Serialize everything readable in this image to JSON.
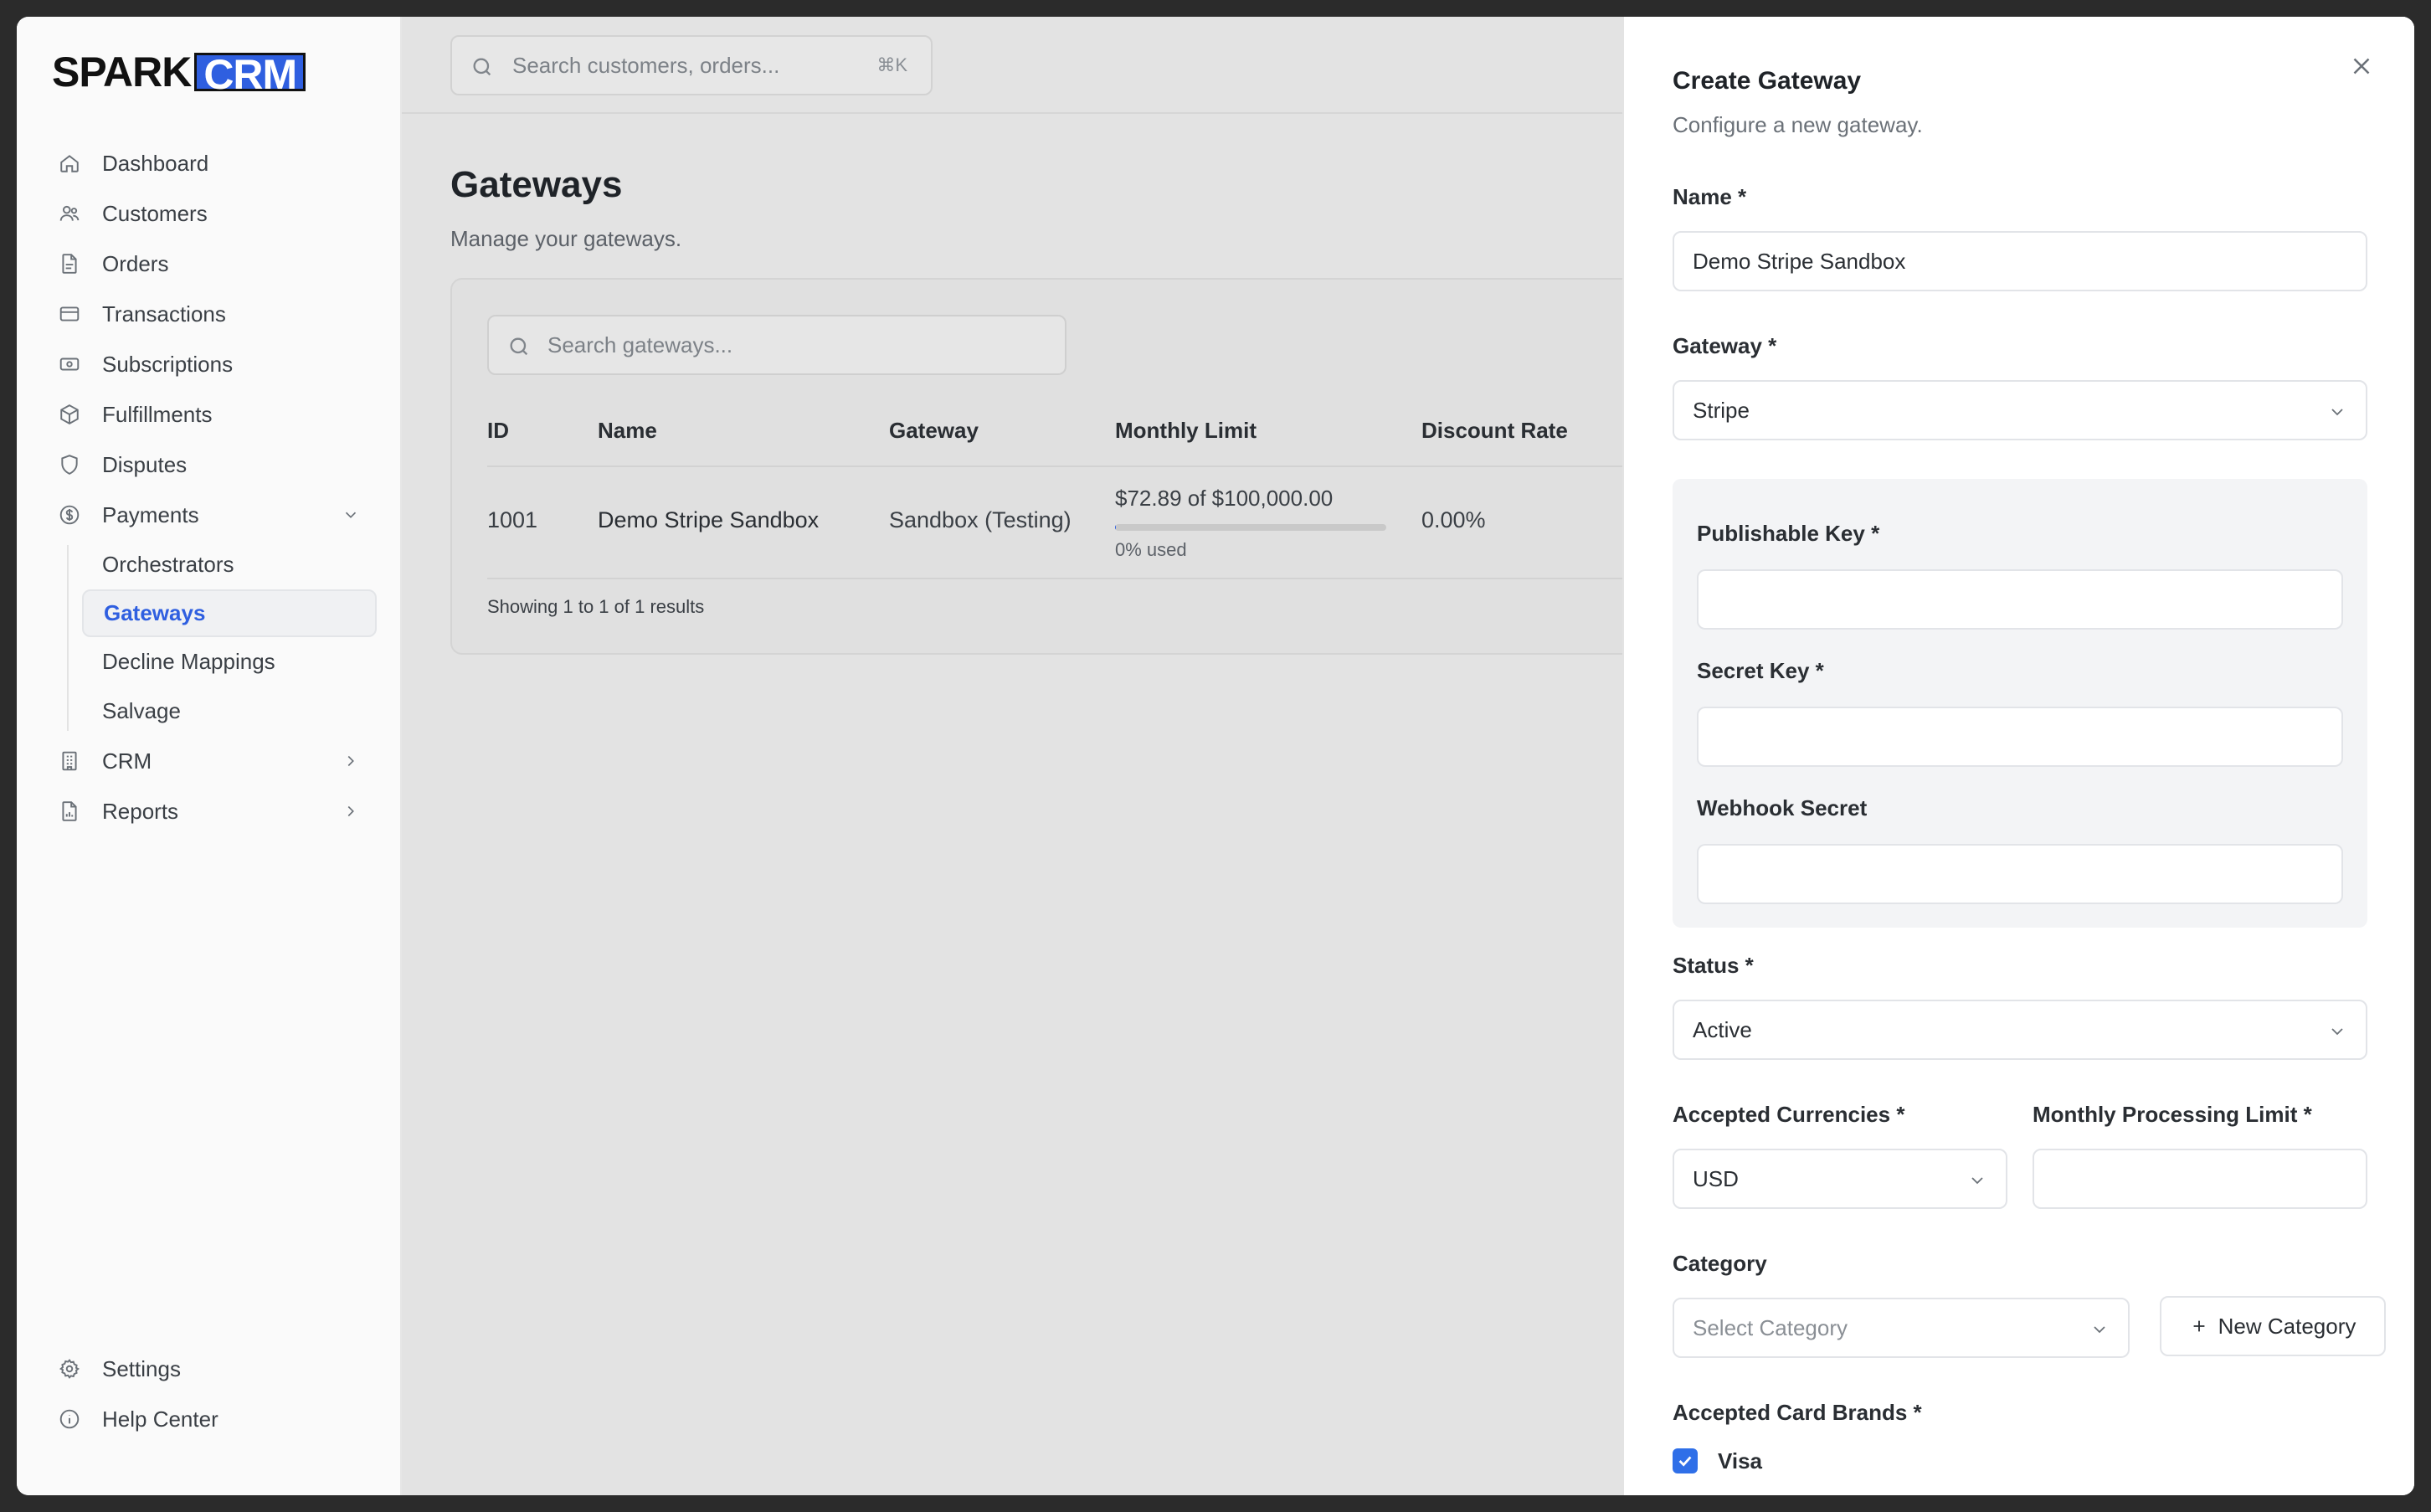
{
  "brand": {
    "part1": "SPARK",
    "part2": "CRM",
    "accent": "#2f5fe0"
  },
  "sidebar": {
    "items": [
      {
        "label": "Dashboard",
        "icon": "home-icon"
      },
      {
        "label": "Customers",
        "icon": "users-icon"
      },
      {
        "label": "Orders",
        "icon": "file-icon"
      },
      {
        "label": "Transactions",
        "icon": "credit-card-icon"
      },
      {
        "label": "Subscriptions",
        "icon": "banknote-icon"
      },
      {
        "label": "Fulfillments",
        "icon": "package-icon"
      },
      {
        "label": "Disputes",
        "icon": "shield-icon"
      },
      {
        "label": "Payments",
        "icon": "dollar-circle-icon",
        "expanded": true
      }
    ],
    "payments_children": [
      "Orchestrators",
      "Gateways",
      "Decline Mappings",
      "Salvage"
    ],
    "active_child": "Gateways",
    "after_items": [
      {
        "label": "CRM",
        "icon": "building-icon"
      },
      {
        "label": "Reports",
        "icon": "report-icon"
      }
    ],
    "bottom": [
      {
        "label": "Settings",
        "icon": "gear-icon"
      },
      {
        "label": "Help Center",
        "icon": "info-icon"
      }
    ]
  },
  "topbar": {
    "search_placeholder": "Search customers, orders...",
    "shortcut": "⌘K"
  },
  "page": {
    "title": "Gateways",
    "subtitle": "Manage your gateways."
  },
  "table": {
    "search_placeholder": "Search gateways...",
    "columns": [
      "ID",
      "Name",
      "Gateway",
      "Monthly Limit",
      "Discount Rate"
    ],
    "rows": [
      {
        "id": "1001",
        "name": "Demo Stripe Sandbox",
        "gateway": "Sandbox (Testing)",
        "limit": "$72.89 of $100,000.00",
        "used": "0% used",
        "used_fraction": 0.0007,
        "discount": "0.00%"
      }
    ],
    "showing": "Showing 1 to 1 of 1 results"
  },
  "drawer": {
    "title": "Create Gateway",
    "subtitle": "Configure a new gateway.",
    "name_label": "Name *",
    "name_value": "Demo Stripe Sandbox",
    "gateway_label": "Gateway *",
    "gateway_value": "Stripe",
    "publishable_label": "Publishable Key *",
    "secret_label": "Secret Key *",
    "webhook_label": "Webhook Secret",
    "status_label": "Status *",
    "status_value": "Active",
    "currencies_label": "Accepted Currencies *",
    "currencies_value": "USD",
    "limit_label": "Monthly Processing Limit *",
    "category_label": "Category",
    "category_placeholder": "Select Category",
    "new_category": "New Category",
    "brands_label": "Accepted Card Brands *",
    "brand_visa": "Visa"
  }
}
